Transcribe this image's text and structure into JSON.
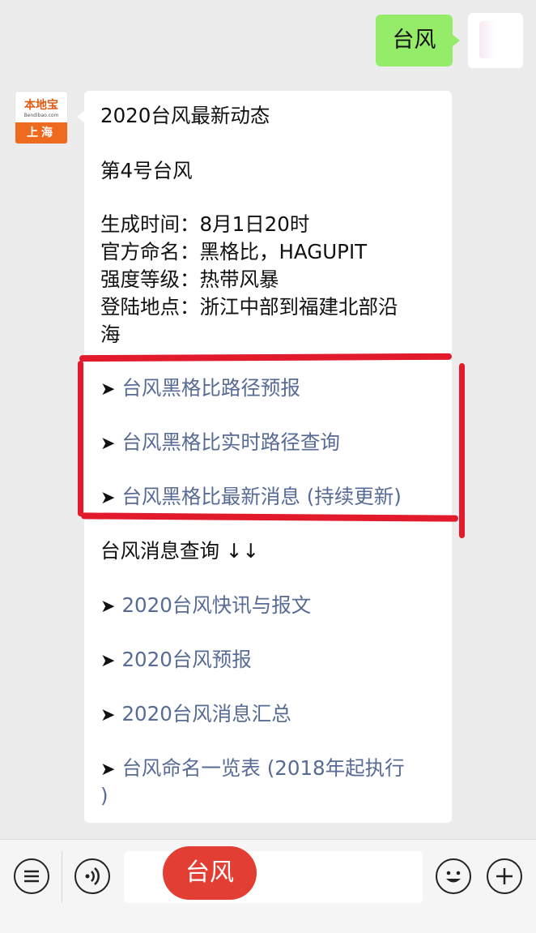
{
  "outgoing_message": {
    "text": "台风"
  },
  "sender": {
    "logo_brand": "本地宝",
    "logo_url": "Bendibao.com",
    "logo_city": "上海"
  },
  "article": {
    "heading": "2020台风最新动态",
    "subheading": "第4号台风",
    "details": [
      "生成时间：8月1日20时",
      "官方命名：黑格比，HAGUPIT",
      "强度等级：热带风暴",
      "登陆地点：浙江中部到福建北部沿",
      "海"
    ],
    "arrow_glyph": "➤",
    "highlighted_links": [
      "台风黑格比路径预报",
      "台风黑格比实时路径查询",
      "台风黑格比最新消息 (持续更新)"
    ],
    "query_heading": "台风消息查询 ↓↓",
    "more_links": [
      "2020台风快讯与报文",
      "2020台风预报",
      "2020台风消息汇总",
      "台风命名一览表 (2018年起执行"
    ],
    "tail_line": ")"
  },
  "input_bar": {
    "icons": [
      "menu-list-icon",
      "voice-icon",
      "emoji-icon",
      "plus-icon"
    ],
    "voice_overlay_text": "台风"
  },
  "colors": {
    "outgoing_bubble": "#95ec69",
    "link": "#576b95",
    "annotation_red": "#e21b2c",
    "voice_pill": "#e23e34"
  }
}
